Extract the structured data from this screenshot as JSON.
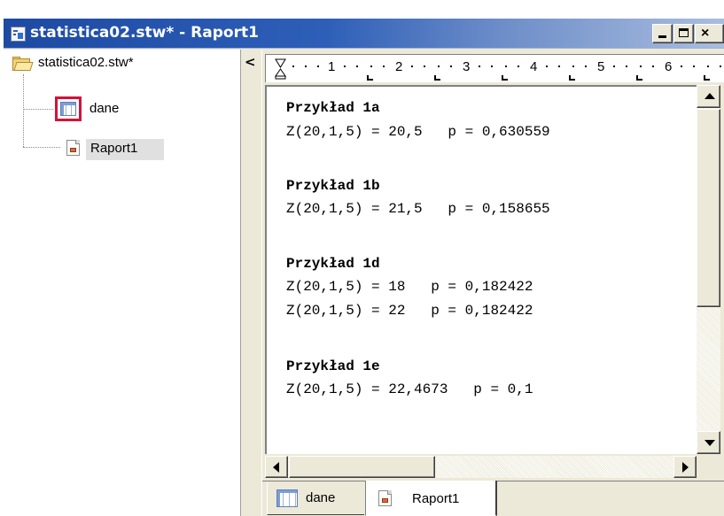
{
  "window": {
    "title_file": "statistica02.stw*",
    "title_sep": " - ",
    "title_doc": "Raport1",
    "buttons": {
      "minimize": "minimize",
      "maximize": "maximize",
      "close": "×"
    }
  },
  "tree": {
    "root": {
      "label": "statistica02.stw*",
      "icon": "folder-open-icon"
    },
    "items": [
      {
        "label": "dane",
        "icon": "spreadsheet-icon",
        "selected_icon": true
      },
      {
        "label": "Raport1",
        "icon": "report-icon",
        "highlighted": true
      }
    ]
  },
  "splitter": {
    "collapse_glyph": "<"
  },
  "ruler": {
    "numbers": [
      "1",
      "2",
      "3",
      "4",
      "5",
      "6"
    ]
  },
  "report": {
    "lines": [
      {
        "text": "Przykład 1a",
        "bold": true
      },
      {
        "text": "Z(20,1,5) = 20,5   p = 0,630559",
        "bold": false
      },
      {
        "text": "",
        "bold": false
      },
      {
        "text": "Przykład 1b",
        "bold": true
      },
      {
        "text": "Z(20,1,5) = 21,5   p = 0,158655",
        "bold": false
      },
      {
        "text": "",
        "bold": false
      },
      {
        "text": "Przykład 1d",
        "bold": true
      },
      {
        "text": "Z(20,1,5) = 18   p = 0,182422",
        "bold": false
      },
      {
        "text": "Z(20,1,5) = 22   p = 0,182422",
        "bold": false
      },
      {
        "text": "",
        "bold": false
      },
      {
        "text": "Przykład 1e",
        "bold": true
      },
      {
        "text": "Z(20,1,5) = 22,4673   p = 0,1",
        "bold": false
      }
    ]
  },
  "tabs": [
    {
      "label": "dane",
      "icon": "spreadsheet-icon",
      "active": false
    },
    {
      "label": "Raport1",
      "icon": "report-icon",
      "active": true
    }
  ],
  "colors": {
    "titlebar_start": "#1d4aa3",
    "titlebar_end": "#a9bddf",
    "selection_border": "#d2133a",
    "face": "#ece9d8"
  }
}
